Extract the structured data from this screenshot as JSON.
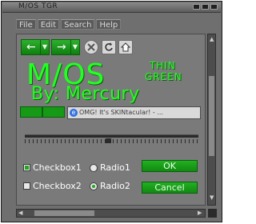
{
  "window": {
    "title": "M/OS TGR"
  },
  "menu": {
    "items": [
      "File",
      "Edit",
      "Search",
      "Help"
    ]
  },
  "toolbar": {
    "back_label": "←",
    "forward_label": "→",
    "dropdown_glyph": "▼",
    "stop_icon": "close-icon",
    "refresh_icon": "refresh-icon",
    "home_icon": "home-icon"
  },
  "brand": {
    "logo": "M/OS",
    "thin": "THIN",
    "green": "GREEN",
    "byline": "By: Mercury"
  },
  "address": {
    "text": "OMG! It's SKINtacular! - ..."
  },
  "options": {
    "checkbox1": {
      "label": "Checkbox1",
      "checked": true
    },
    "checkbox2": {
      "label": "Checkbox2",
      "checked": false
    },
    "radio1": {
      "label": "Radio1",
      "checked": false
    },
    "radio2": {
      "label": "Radio2",
      "checked": true
    }
  },
  "buttons": {
    "ok": "OK",
    "cancel": "Cancel"
  },
  "colors": {
    "accent": "#22ff22",
    "button": "#1a9e1a",
    "frame": "#6f6f6f"
  }
}
